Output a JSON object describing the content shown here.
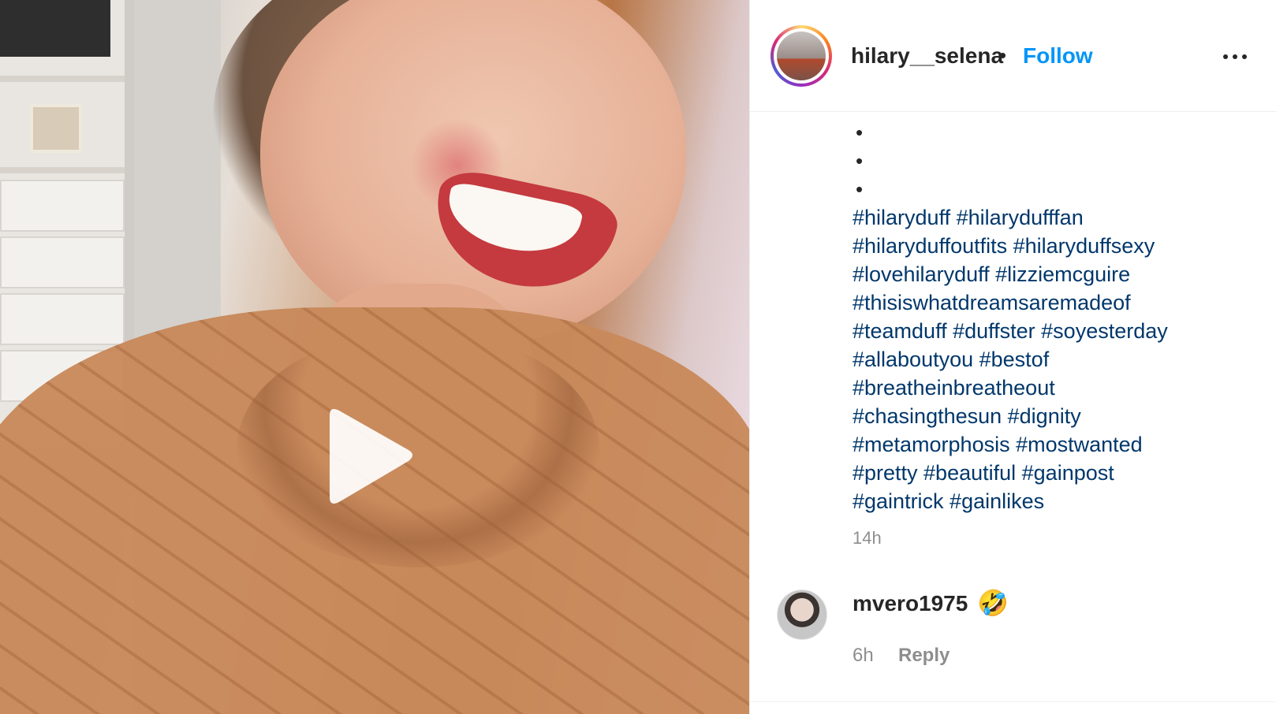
{
  "post": {
    "media_type": "video",
    "play_icon": "play-icon"
  },
  "header": {
    "username": "hilary__selena",
    "separator": "•",
    "follow_label": "Follow",
    "more_icon": "more-options-icon"
  },
  "caption": {
    "bullets": [
      "•",
      "•",
      "•"
    ],
    "hashtag_lines": [
      "#hilaryduff #hilarydufffan",
      "#hilaryduffoutfits #hilaryduffsexy",
      "#lovehilaryduff #lizziemcguire",
      "#thisiswhatdreamsaremadeof",
      "#teamduff #duffster #soyesterday",
      "#allaboutyou #bestof",
      "#breatheinbreatheout",
      "#chasingthesun #dignity",
      "#metamorphosis #mostwanted",
      "#pretty #beautiful #gainpost",
      "#gaintrick #gainlikes"
    ],
    "time": "14h"
  },
  "comments": [
    {
      "username": "mvero1975",
      "text": "🤣",
      "time": "6h",
      "reply_label": "Reply"
    }
  ],
  "colors": {
    "link_blue": "#0095f6",
    "hashtag": "#00376b",
    "muted": "#8e8e8e",
    "text": "#262626"
  }
}
